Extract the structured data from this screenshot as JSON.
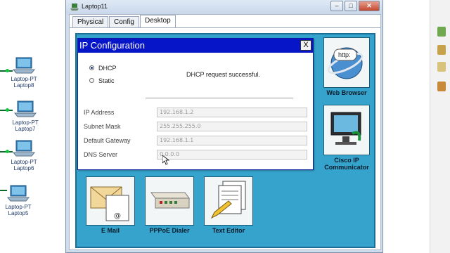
{
  "workspace": {
    "laptops": [
      {
        "line1": "Laptop-PT",
        "line2": "Laptop8"
      },
      {
        "line1": "Laptop-PT",
        "line2": "Laptop7"
      },
      {
        "line1": "Laptop-PT",
        "line2": "Laptop6"
      },
      {
        "line1": "Laptop-PT",
        "line2": "Laptop5"
      }
    ]
  },
  "window": {
    "title": "Laptop11",
    "minimize_icon": "minimize-icon",
    "maximize_icon": "maximize-icon",
    "close_icon": "close-icon"
  },
  "tabs": [
    {
      "label": "Physical",
      "active": false
    },
    {
      "label": "Config",
      "active": false
    },
    {
      "label": "Desktop",
      "active": true
    }
  ],
  "ip_config": {
    "title": "IP Configuration",
    "close_label": "X",
    "dhcp_label": "DHCP",
    "static_label": "Static",
    "selected": "DHCP",
    "status_message": "DHCP request successful.",
    "fields": [
      {
        "label": "IP Address",
        "value": "192.168.1.2"
      },
      {
        "label": "Subnet Mask",
        "value": "255.255.255.0"
      },
      {
        "label": "Default Gateway",
        "value": "192.168.1.1"
      },
      {
        "label": "DNS Server",
        "value": "0.0.0.0"
      }
    ]
  },
  "apps": {
    "web_browser": {
      "label": "Web Browser",
      "icon_text": "http:"
    },
    "cisco_ip": {
      "label_line1": "Cisco IP",
      "label_line2": "Communicator"
    },
    "email": {
      "label": "E Mail"
    },
    "pppoe": {
      "label": "PPPoE Dialer"
    },
    "text_editor": {
      "label": "Text Editor"
    }
  },
  "colors": {
    "desktop_bg": "#35a3cc",
    "dialog_title_bg": "#0615c8"
  }
}
